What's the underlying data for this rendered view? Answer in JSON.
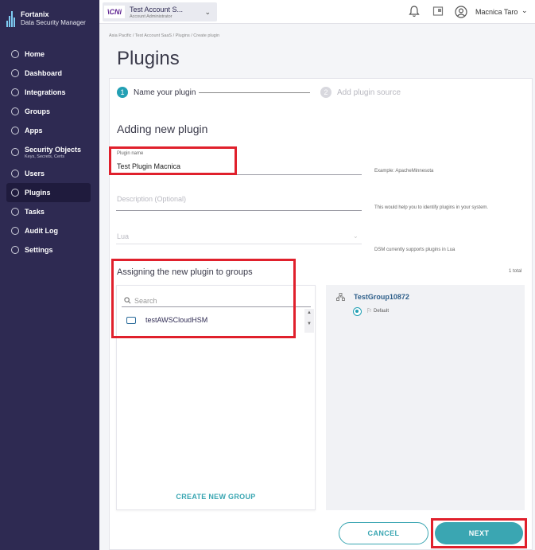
{
  "brand": {
    "line1": "Fortanix",
    "line2": "Data Security Manager"
  },
  "sidebar": {
    "items": [
      {
        "label": "Home",
        "icon": "home-icon"
      },
      {
        "label": "Dashboard",
        "icon": "dashboard-icon"
      },
      {
        "label": "Integrations",
        "icon": "integrations-icon"
      },
      {
        "label": "Groups",
        "icon": "groups-icon"
      },
      {
        "label": "Apps",
        "icon": "apps-icon"
      },
      {
        "label": "Security Objects",
        "sub": "Keys, Secrets, Certs",
        "icon": "security-objects-icon"
      },
      {
        "label": "Users",
        "icon": "users-icon"
      },
      {
        "label": "Plugins",
        "icon": "plugins-icon",
        "active": true
      },
      {
        "label": "Tasks",
        "icon": "tasks-icon"
      },
      {
        "label": "Audit Log",
        "icon": "audit-log-icon"
      },
      {
        "label": "Settings",
        "icon": "settings-icon"
      }
    ]
  },
  "topbar": {
    "account_logo": "\\CNi",
    "account_name": "Test Account S...",
    "account_role": "Account Administrator",
    "user_name": "Macnica Taro"
  },
  "breadcrumb": "Asia Pacific  /  Test Account SaaS  /  Plugins  /  Create plugin",
  "page_title": "Plugins",
  "steps": [
    {
      "number": "1",
      "label": "Name your plugin",
      "active": true
    },
    {
      "number": "2",
      "label": "Add plugin source",
      "active": false
    }
  ],
  "form": {
    "section_title": "Adding new plugin",
    "plugin_name_label": "Plugin name",
    "plugin_name_value": "Test Plugin Macnica",
    "plugin_name_help": "Example: ApacheMinnesota",
    "description_placeholder": "Description (Optional)",
    "description_help": "This would help you to identify plugins in your system.",
    "language_value": "Lua",
    "language_help": "DSM currently supports plugins in Lua"
  },
  "groups": {
    "title": "Assigning the new plugin to groups",
    "total": "1 total",
    "search_placeholder": "Search",
    "available": [
      {
        "label": "testAWSCloudHSM"
      }
    ],
    "create_label": "CREATE NEW GROUP",
    "selected": [
      {
        "name": "TestGroup10872",
        "default_label": "Default"
      }
    ]
  },
  "buttons": {
    "cancel": "CANCEL",
    "next": "NEXT"
  },
  "colors": {
    "sidebar": "#2e2a52",
    "accent": "#3aa6b2",
    "annotation": "#e0202c"
  }
}
